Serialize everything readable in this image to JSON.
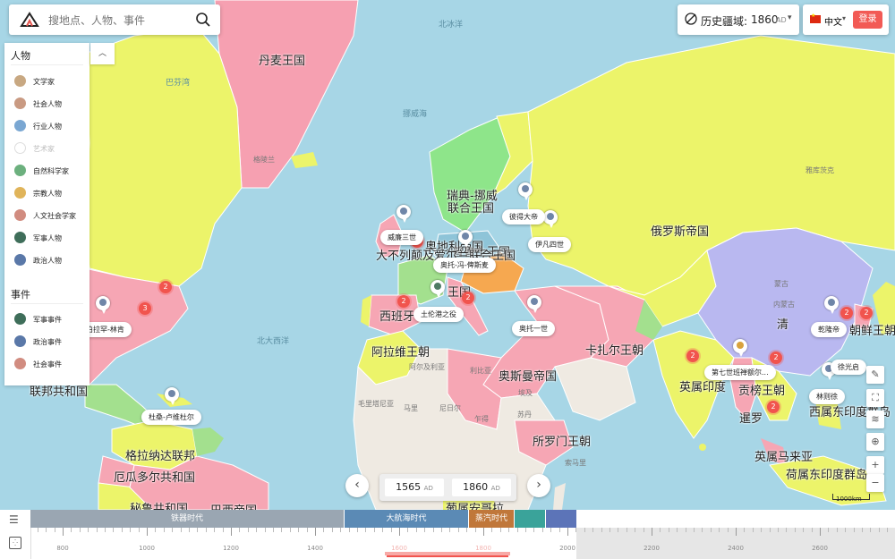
{
  "search": {
    "placeholder": "搜地点、人物、事件"
  },
  "era_selector": {
    "label": "历史疆域:",
    "year": "1860",
    "suffix": "AD"
  },
  "language": {
    "label": "中文",
    "login_label": "登录"
  },
  "panel": {
    "people_header": "人物",
    "people": [
      {
        "label": "文学家",
        "color": "#c8a882",
        "active": true
      },
      {
        "label": "社会人物",
        "color": "#c99a82",
        "active": true
      },
      {
        "label": "行业人物",
        "color": "#7aa7d2",
        "active": true
      },
      {
        "label": "艺术家",
        "color": "#e4e4e4",
        "active": false
      },
      {
        "label": "自然科学家",
        "color": "#6cb07e",
        "active": true
      },
      {
        "label": "宗教人物",
        "color": "#e0b45a",
        "active": true
      },
      {
        "label": "人文社会学家",
        "color": "#d18c80",
        "active": true
      },
      {
        "label": "军事人物",
        "color": "#3f6e5a",
        "active": true
      },
      {
        "label": "政治人物",
        "color": "#5a78a8",
        "active": true
      }
    ],
    "events_header": "事件",
    "events": [
      {
        "label": "军事事件",
        "color": "#3f6e5a"
      },
      {
        "label": "政治事件",
        "color": "#5a78a8"
      },
      {
        "label": "社会事件",
        "color": "#d18c80"
      }
    ]
  },
  "map": {
    "countries": [
      "丹麦王国",
      "瑞典-挪威",
      "联合王国",
      "俄罗斯帝国",
      "普鲁士王国",
      "奥地利帝国",
      "西班牙",
      "阿拉维王朝",
      "奥斯曼帝国",
      "卡扎尔王朝",
      "所罗门王朝",
      "英属印度",
      "清",
      "朝鲜王朝",
      "贡榜王朝",
      "暹罗",
      "英属马来亚",
      "荷属东印度群岛",
      "西属东印度群岛",
      "格拉纳达联邦",
      "厄瓜多尔共和国",
      "秘鲁共和国",
      "巴西帝国",
      "联邦共和国",
      "葡属安哥拉",
      "大不列颠及爱尔兰联合王国",
      "王国"
    ],
    "small_labels": [
      "格陵兰",
      "阿尔及利亚",
      "利比亚",
      "埃及",
      "马里",
      "尼日尔",
      "苏丹",
      "毛里塔尼亚",
      "乍得",
      "蒙古",
      "索马里",
      "内蒙古",
      "雅库茨克"
    ],
    "oceans": [
      "北大西洋",
      "巴芬湾",
      "挪威海",
      "北冰洋"
    ],
    "person_tags": [
      "威廉三世",
      "彼得大帝",
      "伊凡四世",
      "奥托-冯-俾斯麦",
      "土伦港之役",
      "奥托一世",
      "亚伯拉罕-林肯",
      "杜桑-卢维杜尔",
      "乾隆帝",
      "第七世班禅额尔...",
      "徐光启",
      "林则徐"
    ],
    "clusters": [
      "3",
      "2",
      "2",
      "3",
      "2",
      "2",
      "2",
      "2",
      "2",
      "2"
    ],
    "scale": "1000km"
  },
  "year_nav": {
    "from": "1565",
    "to": "1860",
    "suffix": "AD"
  },
  "timeline": {
    "eras": [
      {
        "label": "铁器时代",
        "color": "#9aa6b2"
      },
      {
        "label": "大航海时代",
        "color": "#5b8ab5"
      },
      {
        "label": "蒸汽时代",
        "color": "#c0773a"
      },
      {
        "label": "",
        "color": "#3aa39a"
      },
      {
        "label": "",
        "color": "#5c74b8"
      }
    ],
    "ticks": [
      "800",
      "1000",
      "1200",
      "1400",
      "1600",
      "1800",
      "2000",
      "2200",
      "2400",
      "2600"
    ],
    "selection": {
      "from": 1565,
      "to": 1860
    }
  }
}
